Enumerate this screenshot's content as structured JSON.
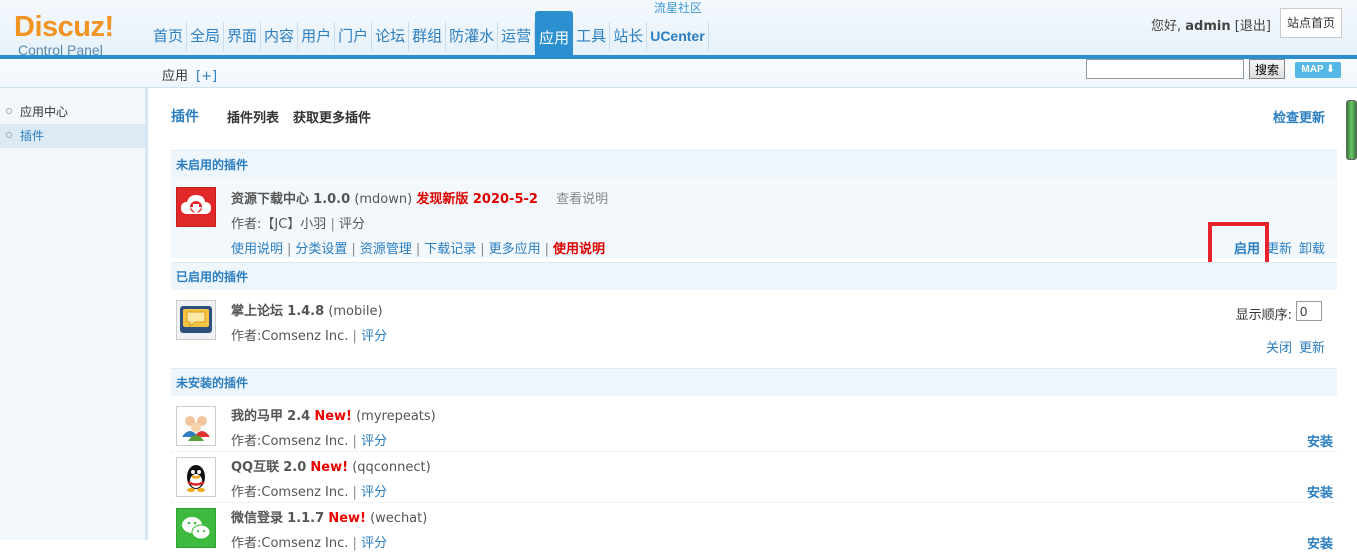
{
  "header": {
    "site_name": "流星社区",
    "logo_text": "Discuz!",
    "logo_sub": "Control Panel",
    "nav": [
      "首页",
      "全局",
      "界面",
      "内容",
      "用户",
      "门户",
      "论坛",
      "群组",
      "防灌水",
      "运营",
      "应用",
      "工具",
      "站长",
      "UCenter"
    ],
    "nav_active": "应用",
    "greeting": "您好,",
    "username": "admin",
    "logout": "[退出]",
    "site_home": "站点首页"
  },
  "subheader": {
    "crumb": "应用",
    "crumb_add": "[+]",
    "search_value": "",
    "search_button": "搜索",
    "map_button": "MAP"
  },
  "sidebar": {
    "items": [
      {
        "label": "应用中心",
        "active": false
      },
      {
        "label": "插件",
        "active": true
      }
    ]
  },
  "main": {
    "tab_title": "插件",
    "tab_list": "插件列表",
    "tab_more": "获取更多插件",
    "check_update": "检查更新",
    "sections": {
      "disabled": "未启用的插件",
      "enabled": "已启用的插件",
      "uninstalled": "未安装的插件"
    },
    "disabled_plugin": {
      "name": "资源下载中心",
      "version": "1.0.0",
      "ident": "(mdown)",
      "new_version": "发现新版 2020-5-2",
      "readme": "查看说明",
      "author_prefix": "作者:",
      "author": "【JC】小羽",
      "rate": "评分",
      "links": [
        "使用说明",
        "分类设置",
        "资源管理",
        "下载记录",
        "更多应用"
      ],
      "link_red": "使用说明",
      "actions": [
        "启用",
        "更新",
        "卸载"
      ]
    },
    "enabled_plugin": {
      "name": "掌上论坛",
      "version": "1.4.8",
      "ident": "(mobile)",
      "author_prefix": "作者:",
      "author": "Comsenz Inc.",
      "rate": "评分",
      "order_label": "显示顺序:",
      "order_value": "0",
      "actions": [
        "关闭",
        "更新"
      ]
    },
    "uninstalled_plugins": [
      {
        "name": "我的马甲",
        "version": "2.4",
        "new": "New!",
        "ident": "(myrepeats)",
        "author_prefix": "作者:",
        "author": "Comsenz Inc.",
        "rate": "评分",
        "action": "安装"
      },
      {
        "name": "QQ互联",
        "version": "2.0",
        "new": "New!",
        "ident": "(qqconnect)",
        "author_prefix": "作者:",
        "author": "Comsenz Inc.",
        "rate": "评分",
        "action": "安装"
      },
      {
        "name": "微信登录",
        "version": "1.1.7",
        "new": "New!",
        "ident": "(wechat)",
        "author_prefix": "作者:",
        "author": "Comsenz Inc.",
        "rate": "评分",
        "action": "安装"
      }
    ]
  },
  "colors": {
    "accent": "#2b8fd0",
    "link": "#2b7ec0",
    "alert_red": "#e8232c",
    "logo_orange": "#f29424"
  }
}
